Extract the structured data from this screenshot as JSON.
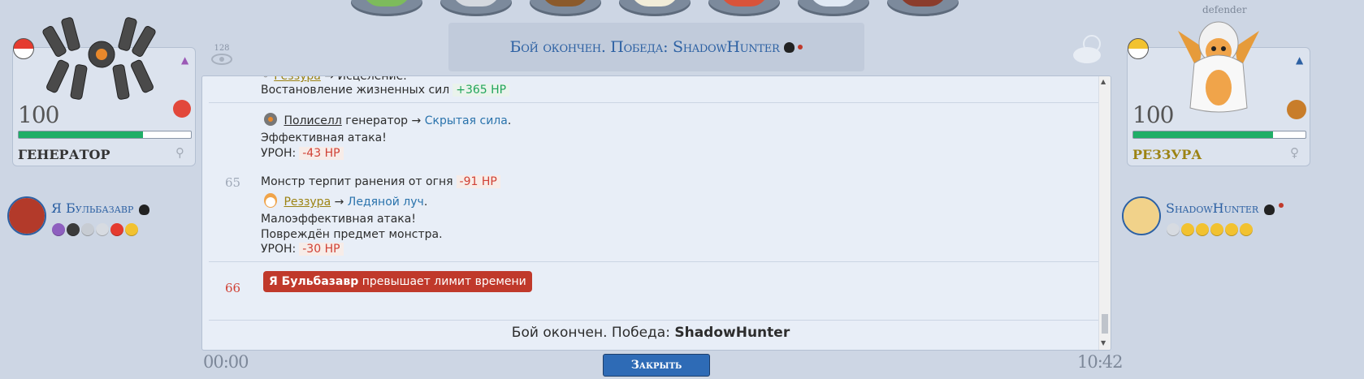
{
  "app": {
    "title": "Бой окончен. Победа: ShadowHunter",
    "views_count": "128"
  },
  "top_menu": {
    "icons": [
      "green-bag-icon",
      "pokeball-device-icon",
      "backpack-icon",
      "envelope-icon",
      "red-bag-icon",
      "blue-disc-icon",
      "book-icon"
    ]
  },
  "left_monster": {
    "level": "100",
    "name": "ГЕНЕРАТОР",
    "hp_fraction": 0.72,
    "hp_color": "#1fae67"
  },
  "right_monster": {
    "level": "100",
    "name": "РЕЗЗУРА",
    "tag": "defender",
    "hp_fraction": 0.81,
    "hp_color": "#1fae67"
  },
  "left_trainer": {
    "name": "Я Бульбазавр",
    "balls": [
      "purple",
      "black-yellow",
      "grey",
      "grey",
      "red",
      "yellow"
    ]
  },
  "right_trainer": {
    "name": "ShadowHunter",
    "balls": [
      "grey",
      "yellow",
      "yellow",
      "yellow",
      "yellow",
      "yellow"
    ]
  },
  "log": {
    "top_partial": {
      "actor": "Реззура",
      "arrow": "→",
      "move": "Исцеление.",
      "effect_text": "Востановление жизненных сил",
      "hp": "+365 HP"
    },
    "turn_64": {
      "actor": "Полиселл",
      "actor_suffix": " генератор",
      "arrow": "→",
      "move": "Скрытая сила",
      "dot": ".",
      "effect": "Эффективная атака!",
      "dmg_label": "УРОН:",
      "dmg_hp": "-43 HP"
    },
    "turn_65": {
      "number": "65",
      "burn_text": "Монстр терпит ранения от огня",
      "burn_hp": "-91 HP",
      "actor": "Реззура",
      "arrow": "→",
      "move": "Ледяной луч",
      "dot": ".",
      "effect": "Малоэффективная атака!",
      "item_text": "Повреждён предмет монстра.",
      "dmg_label": "УРОН:",
      "dmg_hp": "-30 HP"
    },
    "turn_66": {
      "number": "66",
      "banner_name": "Я Бульбазавр",
      "banner_text": " превышает лимит времени"
    },
    "result_text": "Бой окончен. Победа:",
    "result_winner": "ShadowHunter"
  },
  "footer": {
    "timer_left": "00:00",
    "close_label": "Закрыть",
    "timer_right": "10:42"
  }
}
